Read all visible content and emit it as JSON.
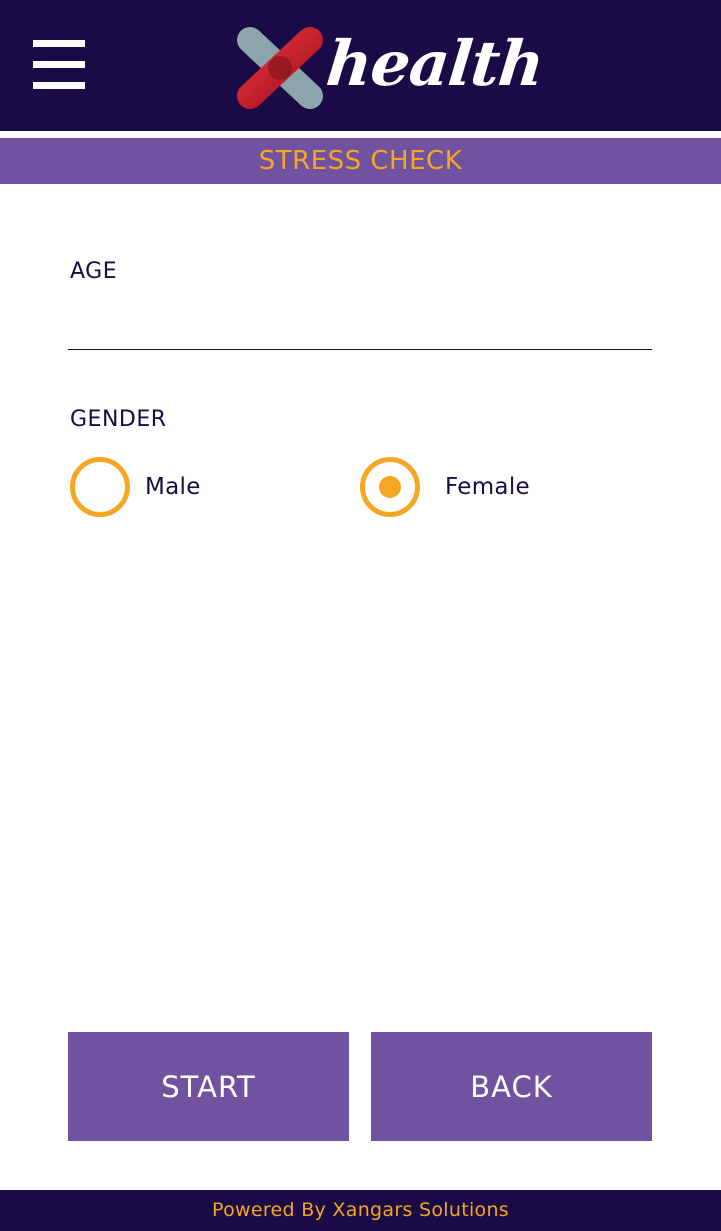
{
  "header": {
    "menu_icon": "hamburger-menu-icon",
    "logo": {
      "mark_icon": "x-cross-logo-icon",
      "word": "health",
      "colors": {
        "red": "#c8202b",
        "grey": "#8ea4ad",
        "text": "#ffffff"
      }
    }
  },
  "title_bar": {
    "title": "STRESS CHECK"
  },
  "form": {
    "age": {
      "label": "AGE",
      "value": ""
    },
    "gender": {
      "label": "GENDER",
      "options": [
        {
          "label": "Male",
          "selected": false
        },
        {
          "label": "Female",
          "selected": true
        }
      ]
    }
  },
  "buttons": {
    "start": "START",
    "back": "BACK"
  },
  "footer": {
    "text": "Powered By Xangars Solutions"
  },
  "colors": {
    "header_bg": "#1a0a45",
    "accent_purple": "#7152a1",
    "accent_orange": "#f5a623",
    "text_dark": "#1a0a45"
  }
}
